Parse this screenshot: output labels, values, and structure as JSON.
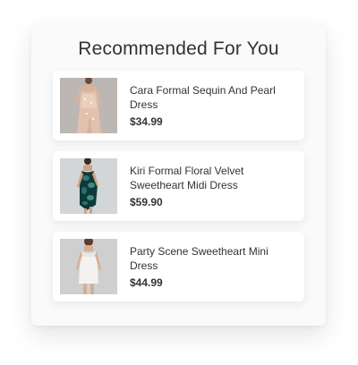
{
  "header": {
    "title": "Recommended For You"
  },
  "products": [
    {
      "name": "Cara Formal Sequin And Pearl Dress",
      "price": "$34.99",
      "image": "blush-sequin-dress-photo"
    },
    {
      "name": "Kiri Formal Floral Velvet Sweetheart Midi Dress",
      "price": "$59.90",
      "image": "teal-floral-velvet-dress-photo"
    },
    {
      "name": "Party Scene Sweetheart Mini Dress",
      "price": "$44.99",
      "image": "white-mini-dress-photo"
    }
  ],
  "colors": {
    "text": "#333333",
    "panel": "#fafafa",
    "card": "#ffffff"
  }
}
